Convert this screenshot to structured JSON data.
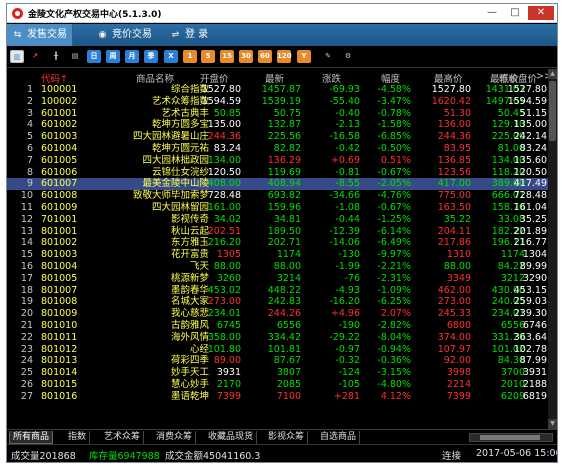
{
  "window": {
    "title": "金陵文化产权交易中心(5.1.3.0)",
    "min_glyph": "—",
    "max_glyph": "□",
    "close_glyph": "✕"
  },
  "menu": {
    "tabs": [
      {
        "label": "发售交易",
        "icon": "trade-icon",
        "glyph": "⇆",
        "active": true
      },
      {
        "label": "竞价交易",
        "icon": "bid-icon",
        "glyph": "◉",
        "active": false
      },
      {
        "label": "登  录",
        "icon": "login-icon",
        "glyph": "⇌",
        "active": false
      }
    ]
  },
  "toolbar": {
    "buttons": [
      {
        "name": "bar-chart-icon",
        "glyph": "▥",
        "style": "sel",
        "color": "#2a7fd6"
      },
      {
        "name": "line-chart-icon",
        "glyph": "↗",
        "style": "",
        "color": "#ff5050"
      },
      {
        "name": "candle-chart-icon",
        "glyph": "╫",
        "style": "",
        "color": "#ffffff"
      },
      {
        "name": "quote-list-icon",
        "glyph": "▤",
        "style": "",
        "color": "#cccccc"
      },
      {
        "name": "toolbar-btn-day-icon",
        "glyph": "日",
        "style": "blue"
      },
      {
        "name": "toolbar-btn-week-icon",
        "glyph": "周",
        "style": "blue"
      },
      {
        "name": "toolbar-btn-month-icon",
        "glyph": "月",
        "style": "blue"
      },
      {
        "name": "toolbar-btn-season-icon",
        "glyph": "季",
        "style": "blue"
      },
      {
        "name": "toolbar-btn-year-icon",
        "glyph": "X",
        "style": "blue"
      },
      {
        "name": "toolbar-btn-1-icon",
        "glyph": "1",
        "style": "orange"
      },
      {
        "name": "toolbar-btn-5-icon",
        "glyph": "5",
        "style": "orange"
      },
      {
        "name": "toolbar-btn-15-icon",
        "glyph": "15",
        "style": "orange"
      },
      {
        "name": "toolbar-btn-30-icon",
        "glyph": "30",
        "style": "orange"
      },
      {
        "name": "toolbar-btn-60-icon",
        "glyph": "60",
        "style": "orange"
      },
      {
        "name": "toolbar-btn-120-icon",
        "glyph": "120",
        "style": "orange"
      },
      {
        "name": "toolbar-btn-y-icon",
        "glyph": "Y",
        "style": "orange"
      },
      {
        "name": "toolbar-btn-edit-icon",
        "glyph": "✎",
        "style": "",
        "color": "#cccccc"
      },
      {
        "name": "settings-gear-icon",
        "glyph": "⚙",
        "style": "",
        "color": "#cccccc"
      }
    ]
  },
  "table": {
    "columns": [
      "代码",
      "商品名称",
      "开盘价",
      "最新",
      "涨跌",
      "幅度",
      "最高价",
      "最低价",
      "昨收盘价"
    ],
    "sort_arrow": "↑",
    "more_arrow": ">>",
    "colors": {
      "up": "#ff3030",
      "down": "#00e000",
      "flat": "#ffffff",
      "text": "#ffff4d"
    },
    "rows": [
      {
        "i": "1",
        "code": "100001",
        "name": "综合指数",
        "open": "1527.80",
        "last": "1457.87",
        "chg": "-69.93",
        "pct": "-4.58%",
        "high": "1527.80",
        "low": "1431.03",
        "prev": "1527.80",
        "oc": "flat",
        "lc": "down",
        "cc": "down",
        "hc": "flat",
        "loc": "down"
      },
      {
        "i": "2",
        "code": "100002",
        "name": "艺术众筹指数",
        "open": "1594.59",
        "last": "1539.19",
        "chg": "-55.40",
        "pct": "-3.47%",
        "high": "1620.42",
        "low": "1497.65",
        "prev": "1594.59",
        "oc": "flat",
        "lc": "down",
        "cc": "down",
        "hc": "up",
        "loc": "down"
      },
      {
        "i": "3",
        "code": "601001",
        "name": "艺术古典丰",
        "open": "50.85",
        "last": "50.75",
        "chg": "-0.40",
        "pct": "-0.78%",
        "high": "51.30",
        "low": "50.45",
        "prev": "51.15",
        "oc": "down",
        "lc": "down",
        "cc": "down",
        "hc": "up",
        "loc": "down"
      },
      {
        "i": "4",
        "code": "601002",
        "name": "乾坤方圆多宝",
        "open": "135.00",
        "last": "132.87",
        "chg": "-2.13",
        "pct": "-1.58%",
        "high": "136.00",
        "low": "129.10",
        "prev": "135.00",
        "oc": "flat",
        "lc": "down",
        "cc": "down",
        "hc": "up",
        "loc": "down"
      },
      {
        "i": "5",
        "code": "601003",
        "name": "四大园林避暑山庄",
        "open": "244.36",
        "last": "225.56",
        "chg": "-16.58",
        "pct": "-6.85%",
        "high": "244.36",
        "low": "225.00",
        "prev": "242.14",
        "oc": "up",
        "lc": "down",
        "cc": "down",
        "hc": "up",
        "loc": "down"
      },
      {
        "i": "6",
        "code": "601004",
        "name": "乾坤方圆元祐",
        "open": "83.24",
        "last": "82.82",
        "chg": "-0.42",
        "pct": "-0.50%",
        "high": "83.95",
        "low": "81.00",
        "prev": "83.24",
        "oc": "flat",
        "lc": "down",
        "cc": "down",
        "hc": "up",
        "loc": "down"
      },
      {
        "i": "7",
        "code": "601005",
        "name": "四大园林拙政园",
        "open": "134.00",
        "last": "136.29",
        "chg": "+0.69",
        "pct": "0.51%",
        "high": "136.85",
        "low": "134.00",
        "prev": "135.60",
        "oc": "down",
        "lc": "up",
        "cc": "up",
        "hc": "up",
        "loc": "down"
      },
      {
        "i": "8",
        "code": "601006",
        "name": "云锦仕女浣纱",
        "open": "120.50",
        "last": "119.69",
        "chg": "-0.81",
        "pct": "-0.67%",
        "high": "123.56",
        "low": "118.20",
        "prev": "120.50",
        "oc": "flat",
        "lc": "down",
        "cc": "down",
        "hc": "up",
        "loc": "down"
      },
      {
        "i": "9",
        "code": "601007",
        "name": "最美金陵中山陵",
        "open": "408.00",
        "last": "408.94",
        "chg": "-8.55",
        "pct": "-2.05%",
        "high": "417.00",
        "low": "389.00",
        "prev": "417.49",
        "oc": "down",
        "lc": "down",
        "cc": "down",
        "hc": "down",
        "loc": "down",
        "selected": true
      },
      {
        "i": "10",
        "code": "601008",
        "name": "致敬大师毕加索梦",
        "open": "728.48",
        "last": "693.82",
        "chg": "-34.66",
        "pct": "-4.76%",
        "high": "775.00",
        "low": "666.01",
        "prev": "728.48",
        "oc": "flat",
        "lc": "down",
        "cc": "down",
        "hc": "up",
        "loc": "down"
      },
      {
        "i": "11",
        "code": "601009",
        "name": "四大园林留园",
        "open": "161.00",
        "last": "159.96",
        "chg": "-1.08",
        "pct": "-0.67%",
        "high": "163.50",
        "low": "158.70",
        "prev": "161.04",
        "oc": "down",
        "lc": "down",
        "cc": "down",
        "hc": "up",
        "loc": "down"
      },
      {
        "i": "12",
        "code": "701001",
        "name": "影视传奇",
        "open": "34.02",
        "last": "34.81",
        "chg": "-0.44",
        "pct": "-1.25%",
        "high": "35.22",
        "low": "33.08",
        "prev": "35.25",
        "oc": "down",
        "lc": "down",
        "cc": "down",
        "hc": "down",
        "loc": "down"
      },
      {
        "i": "13",
        "code": "801001",
        "name": "秋山云起",
        "open": "202.51",
        "last": "189.50",
        "chg": "-12.39",
        "pct": "-6.14%",
        "high": "204.11",
        "low": "182.22",
        "prev": "201.89",
        "oc": "up",
        "lc": "down",
        "cc": "down",
        "hc": "up",
        "loc": "down"
      },
      {
        "i": "14",
        "code": "801002",
        "name": "东方雅玉",
        "open": "216.20",
        "last": "202.71",
        "chg": "-14.06",
        "pct": "-6.49%",
        "high": "217.86",
        "low": "196.11",
        "prev": "216.77",
        "oc": "down",
        "lc": "down",
        "cc": "down",
        "hc": "up",
        "loc": "down"
      },
      {
        "i": "15",
        "code": "801003",
        "name": "花开富贵",
        "open": "1305",
        "last": "1174",
        "chg": "-130",
        "pct": "-9.97%",
        "high": "1310",
        "low": "1174",
        "prev": "1304",
        "oc": "up",
        "lc": "down",
        "cc": "down",
        "hc": "up",
        "loc": "down"
      },
      {
        "i": "16",
        "code": "801004",
        "name": "飞天",
        "open": "88.00",
        "last": "88.00",
        "chg": "-1.99",
        "pct": "-2.21%",
        "high": "88.00",
        "low": "84.22",
        "prev": "89.99",
        "oc": "down",
        "lc": "down",
        "cc": "down",
        "hc": "down",
        "loc": "down"
      },
      {
        "i": "17",
        "code": "801005",
        "name": "桃源新梦",
        "open": "3260",
        "last": "3214",
        "chg": "-76",
        "pct": "-2.31%",
        "high": "3349",
        "low": "3212",
        "prev": "3290",
        "oc": "down",
        "lc": "down",
        "cc": "down",
        "hc": "up",
        "loc": "down"
      },
      {
        "i": "18",
        "code": "801007",
        "name": "墨韵春华",
        "open": "453.02",
        "last": "448.22",
        "chg": "-4.93",
        "pct": "-1.09%",
        "high": "462.00",
        "low": "430.00",
        "prev": "453.15",
        "oc": "down",
        "lc": "down",
        "cc": "down",
        "hc": "up",
        "loc": "down"
      },
      {
        "i": "19",
        "code": "801008",
        "name": "名城大家",
        "open": "273.00",
        "last": "242.83",
        "chg": "-16.20",
        "pct": "-6.25%",
        "high": "273.00",
        "low": "240.05",
        "prev": "259.03",
        "oc": "up",
        "lc": "down",
        "cc": "down",
        "hc": "up",
        "loc": "down"
      },
      {
        "i": "20",
        "code": "801009",
        "name": "我心慈悲",
        "open": "234.01",
        "last": "244.26",
        "chg": "+4.96",
        "pct": "2.07%",
        "high": "245.33",
        "low": "234.01",
        "prev": "239.30",
        "oc": "down",
        "lc": "up",
        "cc": "up",
        "hc": "up",
        "loc": "down"
      },
      {
        "i": "21",
        "code": "801010",
        "name": "古韵雅风",
        "open": "6745",
        "last": "6556",
        "chg": "-190",
        "pct": "-2.82%",
        "high": "6800",
        "low": "6556",
        "prev": "6746",
        "oc": "down",
        "lc": "down",
        "cc": "down",
        "hc": "up",
        "loc": "down"
      },
      {
        "i": "22",
        "code": "801011",
        "name": "海外风情",
        "open": "358.00",
        "last": "334.42",
        "chg": "-29.22",
        "pct": "-8.04%",
        "high": "374.00",
        "low": "331.20",
        "prev": "363.64",
        "oc": "down",
        "lc": "down",
        "cc": "down",
        "hc": "up",
        "loc": "down"
      },
      {
        "i": "23",
        "code": "801012",
        "name": "心经",
        "open": "101.80",
        "last": "101.81",
        "chg": "-0.97",
        "pct": "-0.94%",
        "high": "107.97",
        "low": "101.02",
        "prev": "102.78",
        "oc": "down",
        "lc": "down",
        "cc": "down",
        "hc": "up",
        "loc": "down"
      },
      {
        "i": "24",
        "code": "801013",
        "name": "荷彩四季",
        "open": "89.00",
        "last": "87.67",
        "chg": "-0.32",
        "pct": "-0.36%",
        "high": "92.00",
        "low": "84.30",
        "prev": "87.99",
        "oc": "up",
        "lc": "down",
        "cc": "down",
        "hc": "up",
        "loc": "down"
      },
      {
        "i": "25",
        "code": "801014",
        "name": "妙手天工",
        "open": "3931",
        "last": "3807",
        "chg": "-124",
        "pct": "-3.15%",
        "high": "3998",
        "low": "3700",
        "prev": "3931",
        "oc": "flat",
        "lc": "down",
        "cc": "down",
        "hc": "up",
        "loc": "down"
      },
      {
        "i": "26",
        "code": "801015",
        "name": "慧心妙手",
        "open": "2170",
        "last": "2085",
        "chg": "-105",
        "pct": "-4.80%",
        "high": "2214",
        "low": "2010",
        "prev": "2188",
        "oc": "down",
        "lc": "down",
        "cc": "down",
        "hc": "up",
        "loc": "down"
      },
      {
        "i": "27",
        "code": "801016",
        "name": "墨语乾坤",
        "open": "7399",
        "last": "7100",
        "chg": "+281",
        "pct": "4.12%",
        "high": "7399",
        "low": "6209",
        "prev": "6819",
        "oc": "up",
        "lc": "up",
        "cc": "up",
        "hc": "up",
        "loc": "down"
      }
    ]
  },
  "bottom_tabs": [
    {
      "label": "所有商品",
      "active": true
    },
    {
      "label": "指数",
      "active": false
    },
    {
      "label": "艺术众筹",
      "active": false
    },
    {
      "label": "消费众筹",
      "active": false
    },
    {
      "label": "收藏品现货",
      "active": false
    },
    {
      "label": "影视众筹",
      "active": false
    },
    {
      "label": "自选商品",
      "active": false
    }
  ],
  "status": {
    "volume": "成交量201868",
    "stock": "库存量6947988",
    "amount": "成交金额45041160.3",
    "conn": "连接",
    "datetime": "2017-05-06 15:00"
  }
}
